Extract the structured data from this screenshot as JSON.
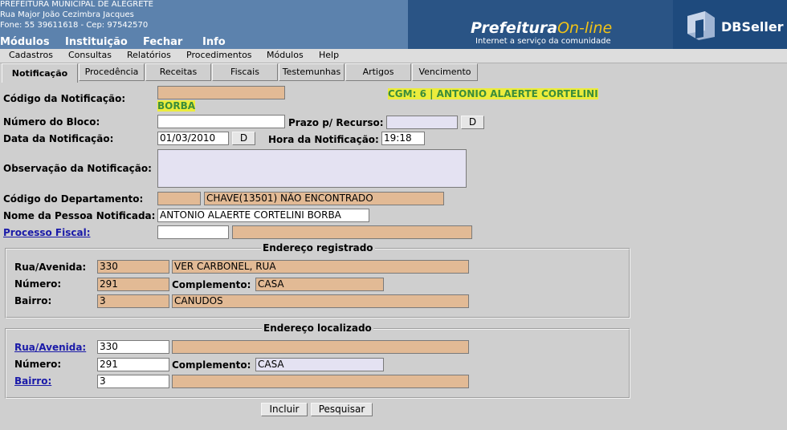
{
  "header": {
    "org_name": "PREFEITURA MUNICIPAL DE ALEGRETE",
    "address": "Rua Major João Cezimbra Jacques",
    "phone": "Fone: 55 39611618  -  Cep: 97542570",
    "brand_main": "Prefeitura",
    "brand_on": "On-line",
    "brand_sub": "Internet a serviço da comunidade",
    "vendor": "DBSeller",
    "nav": [
      "Módulos",
      "Instituição",
      "Fechar",
      "Info"
    ],
    "colors": {
      "header_bg": "#5c82ad",
      "brand_bg": "#2a5485",
      "brand_accent": "#f2c317"
    }
  },
  "menu": [
    "Cadastros",
    "Consultas",
    "Relatórios",
    "Procedimentos",
    "Módulos",
    "Help"
  ],
  "tabs": [
    "Notificação",
    "Procedência",
    "Receitas",
    "Fiscais",
    "Testemunhas",
    "Artigos",
    "Vencimento"
  ],
  "form": {
    "codigo_notificacao": {
      "label": "Código da Notificação:",
      "value": ""
    },
    "cgm": {
      "line1": "CGM: 6  | ANTONIO ALAERTE CORTELINI",
      "line2": "BORBA"
    },
    "numero_bloco": {
      "label": "Número do Bloco:",
      "value": ""
    },
    "prazo_recurso": {
      "label": "Prazo p/ Recurso:",
      "value": "",
      "button": "D"
    },
    "data_notificacao": {
      "label": "Data da Notificação:",
      "value": "01/03/2010",
      "button": "D"
    },
    "hora_notificacao": {
      "label": "Hora da Notificação:",
      "value": "19:18"
    },
    "observacao": {
      "label": "Observação da Notificação:",
      "value": ""
    },
    "codigo_departamento": {
      "label": "Código do Departamento:",
      "code": "",
      "description": "CHAVE(13501) NÃO ENCONTRADO"
    },
    "pessoa_notificada": {
      "label": "Nome da Pessoa Notificada:",
      "value": "ANTONIO ALAERTE CORTELINI BORBA"
    },
    "processo_fiscal": {
      "label": "Processo Fiscal:",
      "code": "",
      "description": ""
    }
  },
  "endereco_registrado": {
    "legend": "Endereço registrado",
    "rua_label": "Rua/Avenida:",
    "rua_code": "330",
    "rua_name": "VER CARBONEL, RUA",
    "numero_label": "Número:",
    "numero": "291",
    "complemento_label": "Complemento:",
    "complemento": "CASA",
    "bairro_label": "Bairro:",
    "bairro_code": "3",
    "bairro_name": "CANUDOS"
  },
  "endereco_localizado": {
    "legend": "Endereço localizado",
    "rua_label": "Rua/Avenida:",
    "rua_code": "330",
    "rua_name": "",
    "numero_label": "Número:",
    "numero": "291",
    "complemento_label": "Complemento:",
    "complemento": "CASA",
    "bairro_label": "Bairro:",
    "bairro_code": "3",
    "bairro_name": ""
  },
  "actions": {
    "incluir": "Incluir",
    "pesquisar": "Pesquisar"
  }
}
